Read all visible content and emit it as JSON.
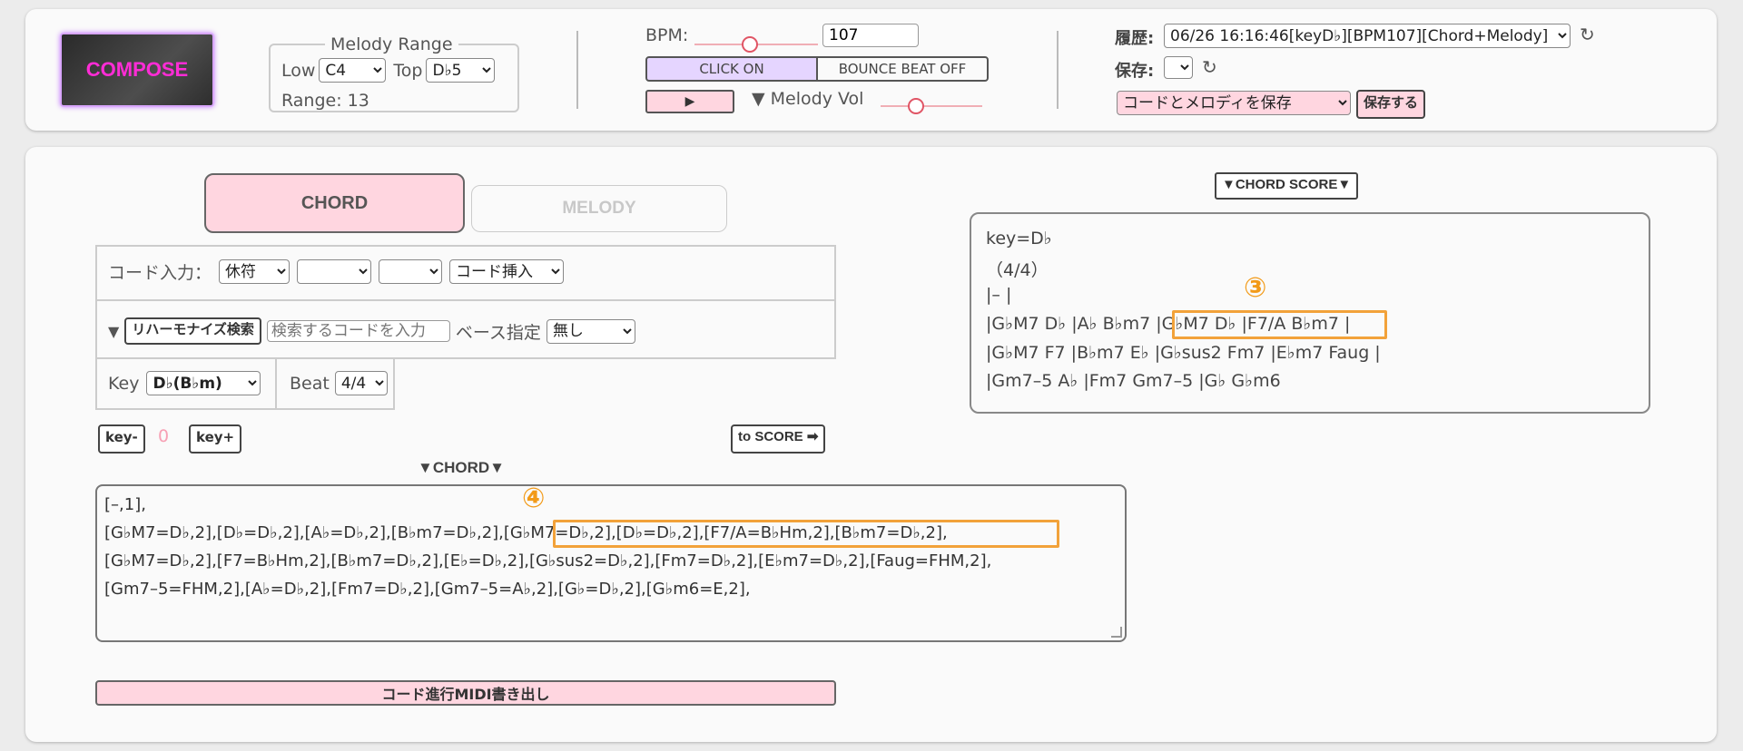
{
  "compose_label": "COMPOSE",
  "melody_range": {
    "legend": "Melody Range",
    "low_label": "Low",
    "low_value": "C4",
    "top_label": "Top",
    "top_value": "D♭5",
    "range_label": "Range: 13"
  },
  "bpm": {
    "label": "BPM:",
    "value": "107",
    "slider_fraction": 0.45
  },
  "click_toggle": "CLICK ON",
  "bounce_toggle": "BOUNCE BEAT OFF",
  "play_icon": "▶",
  "melody_vol": {
    "label": "▼ Melody Vol",
    "slider_fraction": 0.35
  },
  "history": {
    "label": "履歴:",
    "value": "06/26 16:16:46[keyD♭][BPM107][Chord+Melody]",
    "refresh_icon": "↻"
  },
  "save": {
    "label": "保存:",
    "value": "",
    "refresh_icon": "↻",
    "mode_value": "コードとメロディを保存",
    "button": "保存する"
  },
  "tabs": {
    "chord": "CHORD",
    "melody": "MELODY"
  },
  "chord_input": {
    "label": "コード入力：",
    "rest_value": "休符",
    "sel2_value": "",
    "sel3_value": "",
    "insert_value": "コード挿入"
  },
  "reharm": {
    "toggle": "▼",
    "button": "リハーモナイズ検索",
    "search_placeholder": "検索するコードを入力",
    "bass_label": "ベース指定",
    "bass_value": "無し"
  },
  "key": {
    "label": "Key",
    "value": "D♭(B♭m)"
  },
  "beat": {
    "label": "Beat",
    "value": "4/4"
  },
  "transpose": {
    "minus": "key-",
    "value": "0",
    "plus": "key+"
  },
  "to_score": "to SCORE ➡",
  "chord_header": "▼CHORD▼",
  "chord_score_button": "▼CHORD SCORE▼",
  "score_lines": [
    "key=D♭",
    "（4/4）",
    "|– |",
    "|G♭M7 D♭ |A♭ B♭m7 |G♭M7 D♭ |F7/A B♭m7 |",
    "|G♭M7 F7 |B♭m7 E♭ |G♭sus2 Fm7 |E♭m7 Faug |",
    "|Gm7–5 A♭ |Fm7 Gm7–5 |G♭ G♭m6"
  ],
  "chord_lines": [
    "[–,1],",
    "[G♭M7=D♭,2],[D♭=D♭,2],[A♭=D♭,2],[B♭m7=D♭,2],[G♭M7=D♭,2],[D♭=D♭,2],[F7/A=B♭Hm,2],[B♭m7=D♭,2],",
    "[G♭M7=D♭,2],[F7=B♭Hm,2],[B♭m7=D♭,2],[E♭=D♭,2],[G♭sus2=D♭,2],[Fm7=D♭,2],[E♭m7=D♭,2],[Faug=FHM,2],",
    "[Gm7–5=FHM,2],[A♭=D♭,2],[Fm7=D♭,2],[Gm7–5=A♭,2],[G♭=D♭,2],[G♭m6=E,2],"
  ],
  "annotations": {
    "score_marker": "③",
    "chord_marker": "④"
  },
  "midi_button": "コード進行MIDI書き出し",
  "colors": {
    "accent_pink": "#ffd6e0",
    "highlight_orange": "#f2a23a",
    "compose_text": "#ff2cd6"
  }
}
